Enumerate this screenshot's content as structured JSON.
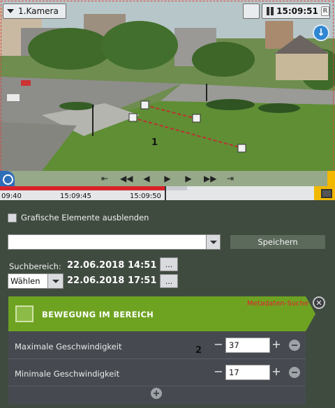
{
  "camera": {
    "label": "1.Kamera"
  },
  "player": {
    "time": "15:09:51",
    "badge": "R"
  },
  "video": {
    "zone_label": "1"
  },
  "timeline": {
    "ticks": [
      "09:40",
      "15:09:45",
      "15:09:50"
    ]
  },
  "options": {
    "hide_graphics_label": "Grafische Elemente ausblenden"
  },
  "search": {
    "combo_value": "",
    "save_label": "Speichern",
    "range_label": "Suchbereich:",
    "from_date": "22.06.2018",
    "from_time": "14:51",
    "select_label": "Wählen",
    "to_date": "22.06.2018",
    "to_time": "17:51",
    "dots": "..."
  },
  "rule": {
    "title": "BEWEGUNG IM BEREICH",
    "meta_label": "Metadaten-Suche",
    "marker": "2",
    "rows": [
      {
        "label": "Maximale Geschwindigkeit",
        "value": "37"
      },
      {
        "label": "Minimale Geschwindigkeit",
        "value": "17"
      }
    ]
  },
  "colors": {
    "accent_green": "#6ea322",
    "timeline_red": "#d8232a",
    "warning_yellow": "#f2b800"
  }
}
